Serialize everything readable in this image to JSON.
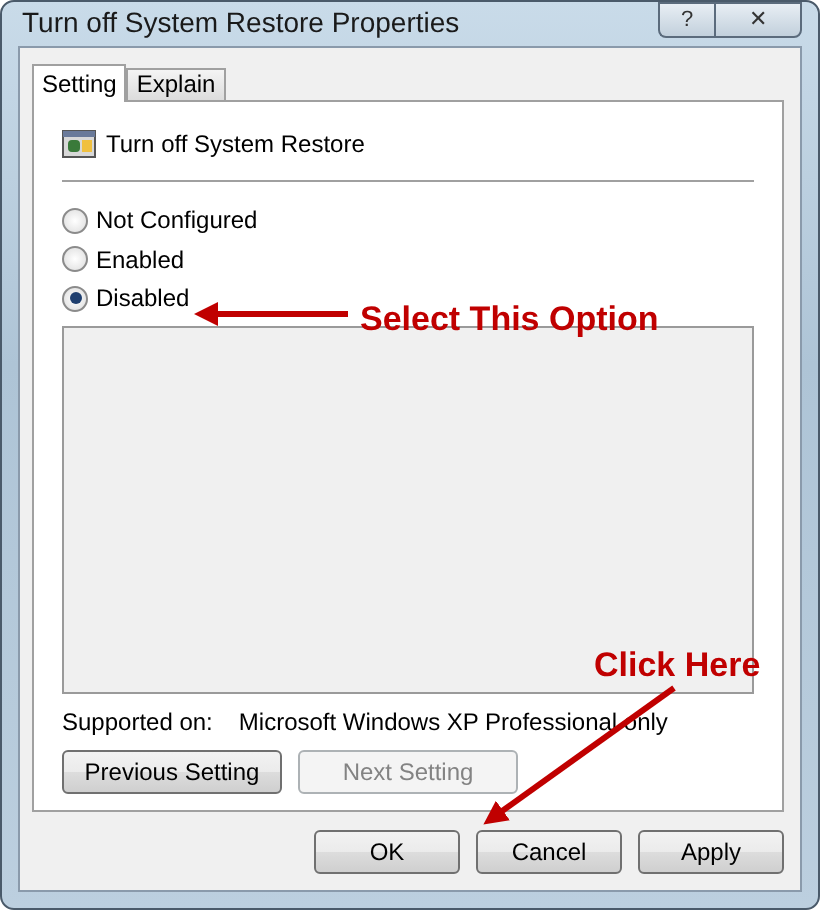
{
  "window": {
    "title": "Turn off System Restore Properties",
    "help_button": "?",
    "close_button": "✕"
  },
  "tabs": [
    {
      "label": "Setting",
      "selected": true
    },
    {
      "label": "Explain",
      "selected": false
    }
  ],
  "policy": {
    "title": "Turn off System Restore"
  },
  "options": [
    {
      "label": "Not Configured",
      "selected": false
    },
    {
      "label": "Enabled",
      "selected": false
    },
    {
      "label": "Disabled",
      "selected": true
    }
  ],
  "supported": {
    "label": "Supported on:",
    "value": "Microsoft Windows XP Professional only"
  },
  "nav_buttons": [
    {
      "label": "Previous Setting",
      "disabled": false
    },
    {
      "label": "Next Setting",
      "disabled": true
    }
  ],
  "buttons": [
    "OK",
    "Cancel",
    "Apply"
  ],
  "annotations": [
    {
      "text": "Select This Option",
      "kind": "left"
    },
    {
      "text": "Click Here",
      "kind": "down"
    }
  ]
}
